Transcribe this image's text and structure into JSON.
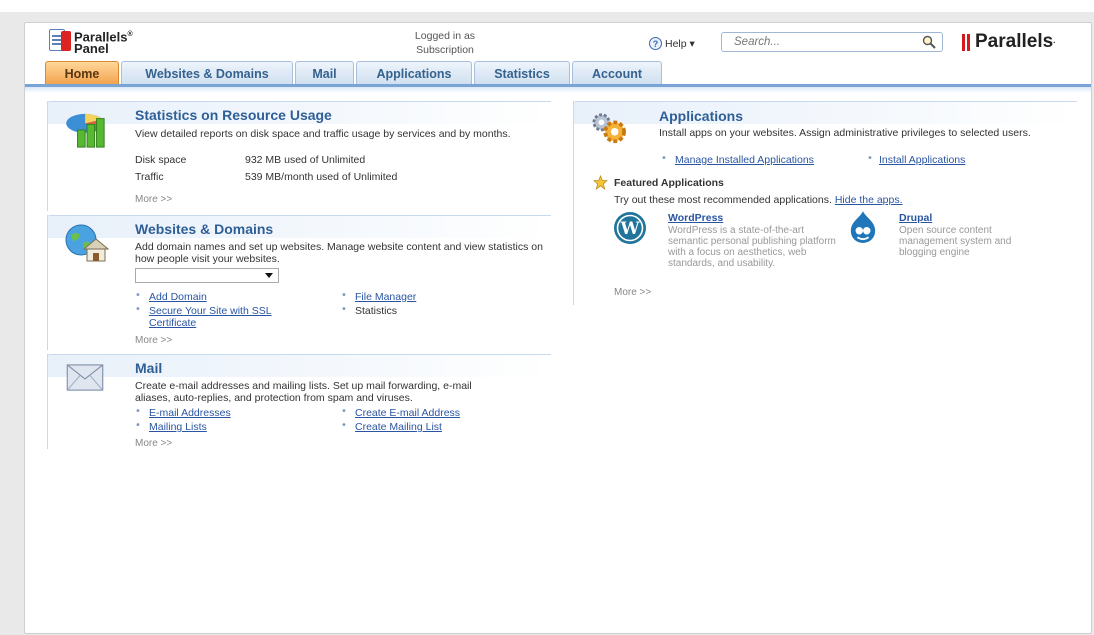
{
  "brand": {
    "panel_line1": "Parallels",
    "panel_reg": "®",
    "panel_line2": "Panel",
    "logo": "Parallels",
    "logo_reg": "·"
  },
  "login": {
    "line1": "Logged in as",
    "line2": "Subscription"
  },
  "help": {
    "label": "Help ▾",
    "icon": "help-icon"
  },
  "search": {
    "placeholder": "Search...",
    "icon": "magnifier-icon"
  },
  "tabs": [
    {
      "label": "Home",
      "active": true
    },
    {
      "label": "Websites & Domains"
    },
    {
      "label": "Mail"
    },
    {
      "label": "Applications"
    },
    {
      "label": "Statistics"
    },
    {
      "label": "Account"
    }
  ],
  "stats": {
    "title": "Statistics on Resource Usage",
    "desc": "View detailed reports on disk space and traffic usage by services and by months.",
    "disk_label": "Disk space",
    "disk_value": "932 MB used of Unlimited",
    "traffic_label": "Traffic",
    "traffic_value": "539 MB/month used of Unlimited",
    "more": "More >>"
  },
  "websites": {
    "title": "Websites & Domains",
    "desc": "Add domain names and set up websites. Manage website content and view statistics on how people visit your websites.",
    "select_value": "",
    "links": [
      "Add Domain",
      "File Manager",
      "Secure Your Site with SSL",
      "Certificate"
    ],
    "statistics": "Statistics",
    "more": "More >>"
  },
  "mail": {
    "title": "Mail",
    "desc_line1": "Create e-mail addresses and mailing lists. Set up mail forwarding, e-mail",
    "desc_line2": "aliases, auto-replies, and protection from spam and viruses.",
    "links": [
      "E-mail Addresses",
      "Create E-mail Address",
      "Mailing Lists",
      "Create Mailing List"
    ],
    "more": "More >>"
  },
  "apps": {
    "title": "Applications",
    "desc": "Install apps on your websites. Assign administrative privileges to selected users.",
    "links": [
      "Manage Installed Applications",
      "Install Applications"
    ],
    "featured_title": "Featured Applications",
    "featured_intro": "Try out these most recommended applications.",
    "hide_link": "Hide the apps.",
    "wordpress": {
      "name": "WordPress",
      "desc": "WordPress is a state-of-the-art semantic personal publishing platform with a focus on aesthetics, web standards, and usability."
    },
    "drupal": {
      "name": "Drupal",
      "desc": "Open source content management system and blogging engine"
    },
    "more": "More >>"
  }
}
